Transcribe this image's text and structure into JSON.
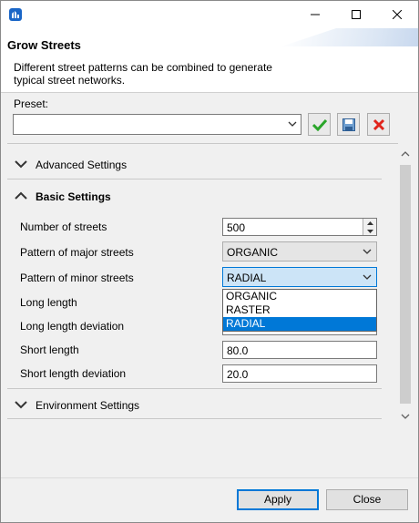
{
  "window": {
    "title": ""
  },
  "header": {
    "title": "Grow Streets",
    "description": "Different street patterns can be combined to generate typical street networks."
  },
  "preset": {
    "label": "Preset:",
    "value": ""
  },
  "sections": {
    "advanced": {
      "label": "Advanced Settings",
      "expanded": false
    },
    "basic": {
      "label": "Basic Settings",
      "expanded": true
    },
    "environment": {
      "label": "Environment Settings",
      "expanded": false
    }
  },
  "basic_settings": {
    "number_of_streets": {
      "label": "Number of streets",
      "value": "500"
    },
    "major_pattern": {
      "label": "Pattern of major streets",
      "value": "ORGANIC"
    },
    "minor_pattern": {
      "label": "Pattern of minor streets",
      "value": "RADIAL",
      "options": [
        "ORGANIC",
        "RASTER",
        "RADIAL"
      ]
    },
    "long_length": {
      "label": "Long length"
    },
    "long_length_deviation": {
      "label": "Long length deviation"
    },
    "short_length": {
      "label": "Short length",
      "value": "80.0"
    },
    "short_length_deviation": {
      "label": "Short length deviation",
      "value": "20.0"
    }
  },
  "buttons": {
    "apply": "Apply",
    "close": "Close"
  },
  "icons": {
    "app": "city-engine-icon",
    "save_preset": "save-icon",
    "apply_preset": "checkmark-icon",
    "delete_preset": "delete-icon"
  },
  "colors": {
    "accent": "#0078d7",
    "check": "#2aa52a",
    "delete": "#e0241b"
  }
}
